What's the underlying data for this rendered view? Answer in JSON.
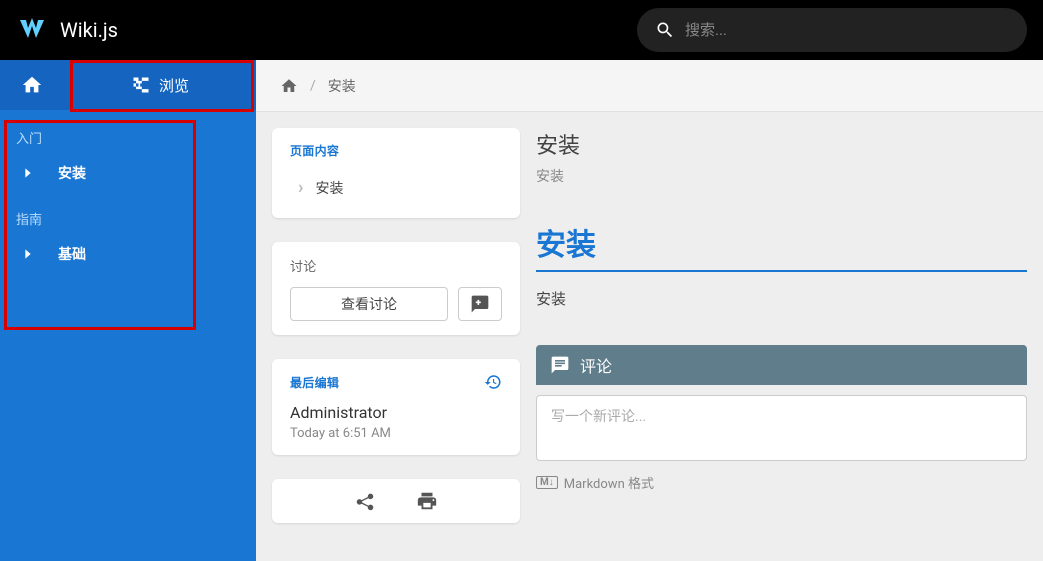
{
  "header": {
    "site_title": "Wiki.js",
    "search_placeholder": "搜索..."
  },
  "sidebar": {
    "browse_label": "浏览",
    "sections": [
      {
        "title": "入门",
        "items": [
          {
            "label": "安装"
          }
        ]
      },
      {
        "title": "指南",
        "items": [
          {
            "label": "基础"
          }
        ]
      }
    ]
  },
  "breadcrumb": {
    "current": "安装",
    "sep": "/"
  },
  "toc": {
    "header": "页面内容",
    "items": [
      "安装"
    ]
  },
  "discussion": {
    "header": "讨论",
    "view_label": "查看讨论"
  },
  "last_edit": {
    "header": "最后编辑",
    "author": "Administrator",
    "time": "Today at 6:51 AM"
  },
  "page": {
    "title": "安装",
    "subtitle": "安装",
    "body_heading": "安装",
    "body_text": "安装"
  },
  "comments": {
    "header": "评论",
    "placeholder": "写一个新评论...",
    "md_hint": "Markdown 格式",
    "md_badge": "M↓"
  }
}
